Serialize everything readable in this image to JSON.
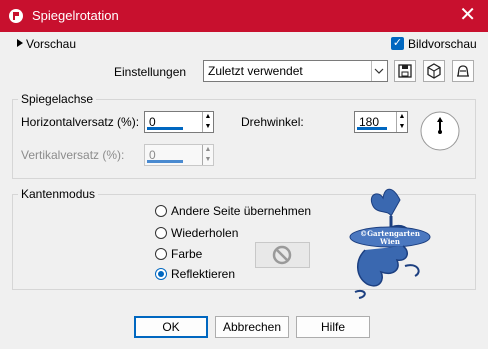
{
  "window": {
    "title": "Spiegelrotation"
  },
  "preview": {
    "expander_label": "Vorschau",
    "checkbox_label": "Bildvorschau",
    "checked": true
  },
  "settings": {
    "label": "Einstellungen",
    "selected": "Zuletzt verwendet"
  },
  "mirror_axis": {
    "title": "Spiegelachse",
    "h_offset_label": "Horizontalversatz (%):",
    "h_offset_value": "0",
    "v_offset_label": "Vertikalversatz (%):",
    "v_offset_value": "0",
    "angle_label": "Drehwinkel:",
    "angle_value": "180"
  },
  "edge_mode": {
    "title": "Kantenmodus",
    "options": [
      "Andere Seite übernehmen",
      "Wiederholen",
      "Farbe",
      "Reflektieren"
    ],
    "selected": "Reflektieren"
  },
  "watermark": {
    "line1": "©Gartengarten",
    "line2": "Wien"
  },
  "buttons": {
    "ok": "OK",
    "cancel": "Abbrechen",
    "help": "Hilfe"
  },
  "colors": {
    "titlebar": "#c8102e",
    "accent": "#0067c0"
  }
}
